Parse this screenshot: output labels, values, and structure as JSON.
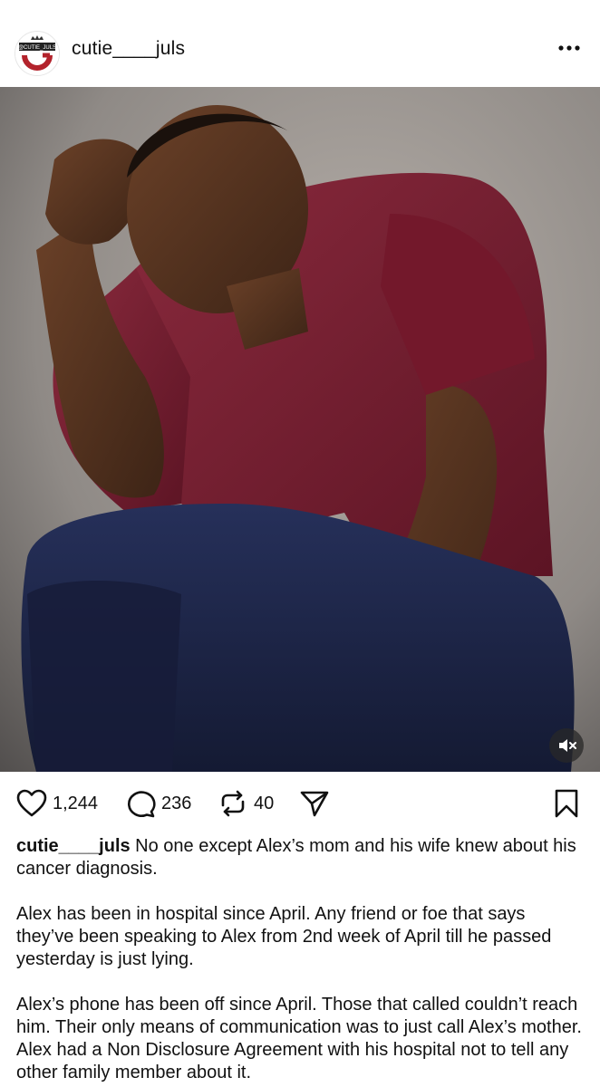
{
  "post": {
    "username": "cutie____juls",
    "avatar_text": "@CUTIE_JULS",
    "more_icon": "ellipsis-icon"
  },
  "stats": {
    "likes": "1,244",
    "comments": "236",
    "reposts": "40"
  },
  "icons": {
    "like": "heart-icon",
    "comment": "comment-bubble-icon",
    "repost": "repost-icon",
    "share": "send-icon",
    "bookmark": "bookmark-icon",
    "mute": "mute-icon"
  },
  "caption": {
    "username": "cutie____juls",
    "line1": " No one except Alex’s mom and his wife knew about his cancer diagnosis.",
    "para2": "Alex has been in hospital since April.  Any friend or foe that says they’ve been speaking to Alex from 2nd week of April till he passed yesterday is just lying.",
    "para3": "Alex’s phone has been off since April. Those that called couldn’t reach him. Their only means of communication was to just call Alex’s mother.  Alex had a Non Disclosure Agreement with his hospital not to tell any other family member about it."
  },
  "colors": {
    "background": "#ffffff",
    "text": "#111111",
    "shirt": "#7a1f33",
    "pants": "#1b2240",
    "photo_bg": "#8f8a86"
  }
}
